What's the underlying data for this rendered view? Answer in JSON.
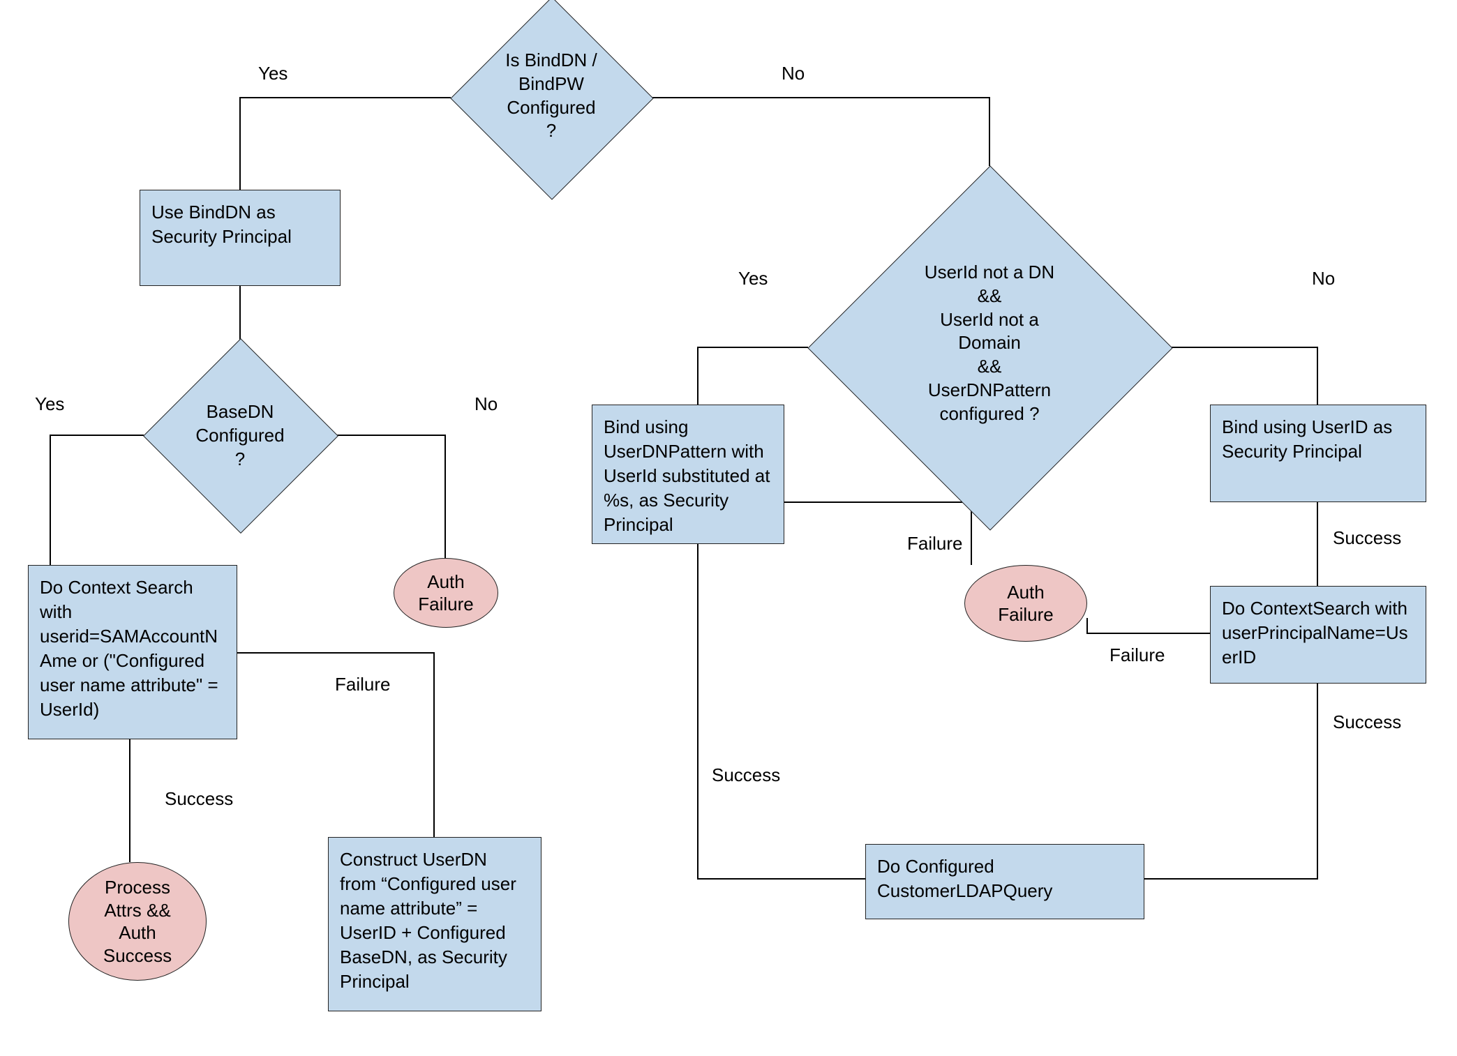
{
  "chart_data": {
    "type": "flowchart",
    "title": "LDAP Authentication Flow",
    "nodes": [
      {
        "id": "d1",
        "shape": "decision",
        "text": "Is BindDN /\nBindPW\nConfigured\n?"
      },
      {
        "id": "r1",
        "shape": "process",
        "text": "Use BindDN as\nSecurity Principal"
      },
      {
        "id": "d2",
        "shape": "decision",
        "text": "BaseDN\nConfigured\n?"
      },
      {
        "id": "r2",
        "shape": "process",
        "text": "Do Context Search\nwith\nuserid=SAMAccountN\nAme or (\"Configured\nuser name attribute\" =\nUserId)"
      },
      {
        "id": "e1",
        "shape": "terminal",
        "text": "Auth\nFailure"
      },
      {
        "id": "e2",
        "shape": "terminal",
        "text": "Process\nAttrs &&\nAuth\nSuccess"
      },
      {
        "id": "r3",
        "shape": "process",
        "text": "Construct UserDN\nfrom “Configured user\nname attribute” =\nUserID + Configured\nBaseDN, as Security\nPrincipal"
      },
      {
        "id": "d3",
        "shape": "decision",
        "text": "UserId not a DN\n&&\nUserId not a\nDomain\n&&\nUserDNPattern\nconfigured ?"
      },
      {
        "id": "r4",
        "shape": "process",
        "text": "Bind using\nUserDNPattern with\nUserId substituted at\n%s, as Security\nPrincipal"
      },
      {
        "id": "r5",
        "shape": "process",
        "text": "Bind using UserID as\nSecurity Principal"
      },
      {
        "id": "r6",
        "shape": "process",
        "text": "Do ContextSearch with\nuserPrincipalName=Us\nerID"
      },
      {
        "id": "e3",
        "shape": "terminal",
        "text": "Auth\nFailure"
      },
      {
        "id": "r7",
        "shape": "process",
        "text": "Do Configured\nCustomerLDAPQuery"
      }
    ],
    "edges": [
      {
        "from": "d1",
        "to": "r1",
        "label": "Yes"
      },
      {
        "from": "d1",
        "to": "d3",
        "label": "No"
      },
      {
        "from": "r1",
        "to": "d2",
        "label": ""
      },
      {
        "from": "d2",
        "to": "r2",
        "label": "Yes"
      },
      {
        "from": "d2",
        "to": "e1",
        "label": "No"
      },
      {
        "from": "r2",
        "to": "e2",
        "label": "Success"
      },
      {
        "from": "r2",
        "to": "r3",
        "label": "Failure"
      },
      {
        "from": "d3",
        "to": "r4",
        "label": "Yes"
      },
      {
        "from": "d3",
        "to": "r5",
        "label": "No"
      },
      {
        "from": "r4",
        "to": "e3",
        "label": "Failure"
      },
      {
        "from": "r4",
        "to": "r7",
        "label": "Success"
      },
      {
        "from": "r5",
        "to": "r6",
        "label": "Success"
      },
      {
        "from": "r6",
        "to": "e3",
        "label": "Failure"
      },
      {
        "from": "r6",
        "to": "r7",
        "label": "Success"
      }
    ]
  },
  "nodes": {
    "d1": "Is BindDN /\nBindPW\nConfigured\n?",
    "r1": "Use BindDN as\nSecurity Principal",
    "d2": "BaseDN\nConfigured\n?",
    "r2": "Do Context Search\nwith\nuserid=SAMAccountN\nAme or (\"Configured\nuser name attribute\" =\nUserId)",
    "e1": "Auth\nFailure",
    "e2": "Process\nAttrs &&\nAuth\nSuccess",
    "r3": "Construct UserDN\nfrom “Configured user\nname attribute” =\nUserID + Configured\nBaseDN, as Security\nPrincipal",
    "d3": "UserId not a DN\n&&\nUserId not a\nDomain\n&&\nUserDNPattern\nconfigured ?",
    "r4": "Bind using\nUserDNPattern with\nUserId substituted at\n%s, as Security\nPrincipal",
    "r5": "Bind using UserID as\nSecurity Principal",
    "r6": "Do ContextSearch with\nuserPrincipalName=Us\nerID",
    "e3": "Auth\nFailure",
    "r7": "Do Configured\nCustomerLDAPQuery"
  },
  "labels": {
    "yes1": "Yes",
    "no1": "No",
    "yes2": "Yes",
    "no2": "No",
    "yes3": "Yes",
    "no3": "No",
    "success1": "Success",
    "failure1": "Failure",
    "success2": "Success",
    "failure2": "Failure",
    "success3": "Success",
    "failure3": "Failure",
    "success4": "Success"
  }
}
